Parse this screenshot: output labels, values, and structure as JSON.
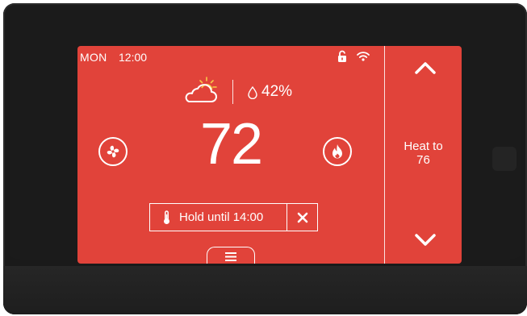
{
  "status_bar": {
    "day": "MON",
    "time": "12:00",
    "icons": [
      "lock-open-icon",
      "wifi-icon"
    ]
  },
  "weather": {
    "icon": "partly-sunny-icon",
    "humidity": "42%",
    "humidity_icon": "droplet-icon"
  },
  "current_temperature": "72",
  "controls": {
    "fan_icon": "fan-icon",
    "mode_icon": "flame-icon"
  },
  "hold": {
    "label": "Hold until 14:00",
    "icon": "thermometer-icon",
    "cancel_icon": "close-icon"
  },
  "menu_icon": "menu-icon",
  "setpoint": {
    "line1": "Heat to",
    "line2": "76",
    "up_icon": "chevron-up-icon",
    "down_icon": "chevron-down-icon"
  },
  "colors": {
    "screen": "#e1433a",
    "bezel": "#1b1b1b",
    "foreground": "#ffffff"
  }
}
